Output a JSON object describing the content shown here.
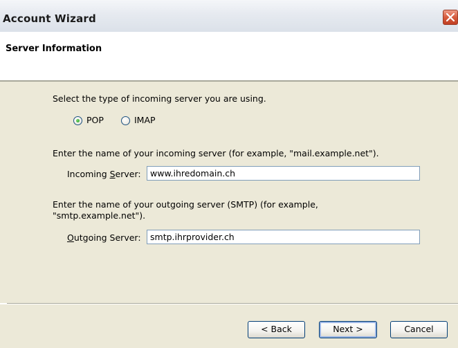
{
  "window": {
    "title": "Account Wizard"
  },
  "header": {
    "title": "Server Information"
  },
  "incoming_type": {
    "prompt": "Select the type of incoming server you are using.",
    "options": [
      {
        "label": "POP",
        "selected": true
      },
      {
        "label": "IMAP",
        "selected": false
      }
    ]
  },
  "incoming": {
    "prompt": "Enter the name of your incoming server (for example, \"mail.example.net\").",
    "label_pre": "Incoming ",
    "label_accel": "S",
    "label_post": "erver:",
    "value": "www.ihredomain.ch"
  },
  "outgoing": {
    "prompt_line1": "Enter the name of your outgoing server (SMTP) (for example,",
    "prompt_line2": "\"smtp.example.net\").",
    "label_accel": "O",
    "label_post": "utgoing Server:",
    "value": "smtp.ihrprovider.ch"
  },
  "buttons": {
    "back": "< Back",
    "next": "Next >",
    "cancel": "Cancel"
  }
}
